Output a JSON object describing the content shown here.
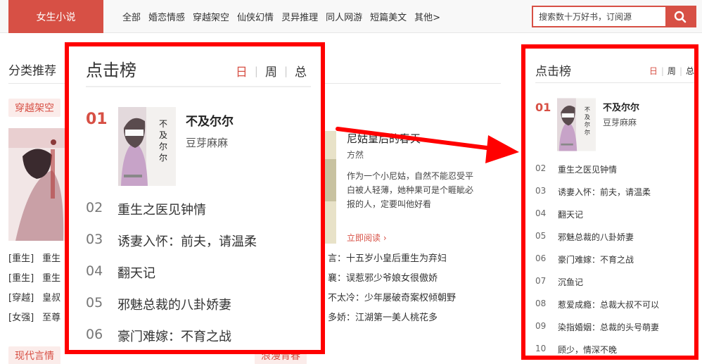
{
  "header": {
    "logo_text": "女生小说",
    "nav": [
      "全部",
      "婚恋情感",
      "穿越架空",
      "仙侠幻情",
      "灵异推理",
      "同人网游",
      "短篇美文",
      "其他>"
    ],
    "search_placeholder": "搜索数十万好书，订阅源"
  },
  "main": {
    "section_title": "分类推荐",
    "tag_chuanyue": "穿越架空",
    "tag_xiandai": "现代言情",
    "tag_langman": "浪漫青春",
    "list_rows": [
      {
        "tag": "[重生]",
        "text": "重生"
      },
      {
        "tag": "[重生]",
        "text": "重生"
      },
      {
        "tag": "[穿越]",
        "text": "皇叔"
      },
      {
        "tag": "[女强]",
        "text": "至尊"
      }
    ],
    "featured": {
      "title": "尼姑皇后的春天",
      "author": "方然",
      "desc": "作为一个小尼姑，自然不能忍受平白被人轻薄，她种果可是个睚眦必报的人，定要叫他好看",
      "read_label": "立即阅读"
    },
    "mid_list": [
      "言：十五岁小皇后重生为弃妇",
      "襄：误惹邪少爷娘女很傲娇",
      "不太冷：少年屡破奇案权倾朝野",
      "多娇：江湖第一美人桃花多"
    ]
  },
  "zoom": {
    "title": "点击榜",
    "tabs": [
      "日",
      "周",
      "总"
    ],
    "top": {
      "rank": "01",
      "title": "不及尔尔",
      "author": "豆芽麻麻"
    },
    "items": [
      {
        "num": "02",
        "title": "重生之医见钟情"
      },
      {
        "num": "03",
        "title": "诱妻入怀：前夫，请温柔"
      },
      {
        "num": "04",
        "title": "翻天记"
      },
      {
        "num": "05",
        "title": "邪魅总裁的八卦娇妻"
      },
      {
        "num": "06",
        "title": "豪门难嫁：不育之战"
      }
    ]
  },
  "ranking": {
    "title": "点击榜",
    "tabs": [
      "日",
      "周",
      "总"
    ],
    "top": {
      "rank": "01",
      "title": "不及尔尔",
      "author": "豆芽麻麻"
    },
    "items": [
      {
        "num": "02",
        "title": "重生之医见钟情"
      },
      {
        "num": "03",
        "title": "诱妻入怀：前夫，请温柔"
      },
      {
        "num": "04",
        "title": "翻天记"
      },
      {
        "num": "05",
        "title": "邪魅总裁的八卦娇妻"
      },
      {
        "num": "06",
        "title": "豪门难嫁：不育之战"
      },
      {
        "num": "07",
        "title": "沉鱼记"
      },
      {
        "num": "08",
        "title": "惹爱成瘾：总裁大叔不可以"
      },
      {
        "num": "09",
        "title": "染指婚姻：总裁的头号萌妻"
      },
      {
        "num": "10",
        "title": "顾少，情深不晚"
      }
    ]
  },
  "colors": {
    "accent": "#d75045",
    "highlight_border": "#ff0000"
  }
}
